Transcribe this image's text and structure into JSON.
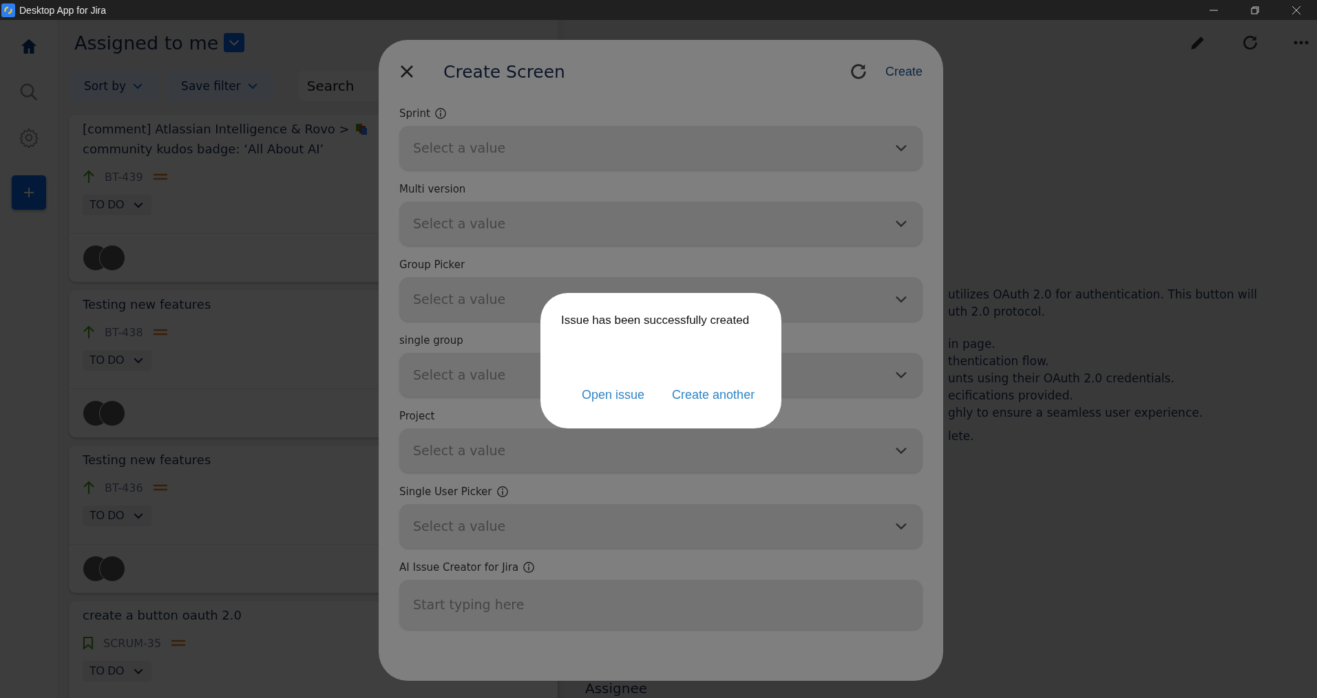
{
  "window": {
    "title": "Desktop App for Jira"
  },
  "sidebar": {
    "items": [
      {
        "kind": "home",
        "selected": true
      },
      {
        "kind": "search",
        "selected": false
      },
      {
        "kind": "settings",
        "selected": false
      },
      {
        "kind": "add",
        "selected": false
      }
    ]
  },
  "list": {
    "title": "Assigned to me",
    "buttons": [
      "Sort by",
      "Save filter"
    ],
    "search": {
      "placeholder": "Search"
    },
    "issues": [
      {
        "title": "[comment] Atlassian Intelligence & Rovo >",
        "title_cont": "community kudos badge: ‘All About AI’",
        "kind": "improvement",
        "key": "BT-439",
        "status": "TO DO"
      },
      {
        "title": "Testing new features",
        "kind": "improvement",
        "key": "BT-438",
        "status": "TO DO"
      },
      {
        "title": "Testing new features",
        "kind": "improvement",
        "key": "BT-436",
        "status": "TO DO"
      },
      {
        "title": "create a button oauth 2.0",
        "kind": "story",
        "key": "SCRUM-35",
        "status": "TO DO"
      }
    ]
  },
  "detail": {
    "paragraphs": [
      [
        "utilizes OAuth 2.0 for authentication. This button will",
        "uth 2.0 protocol."
      ],
      [
        "in page.",
        "thentication flow.",
        "unts using their OAuth 2.0 credentials.",
        "ecifications provided.",
        "ghly to ensure a seamless user experience."
      ],
      [
        "lete."
      ]
    ],
    "assignee_label": "Assignee"
  },
  "modal": {
    "title": "Create Screen",
    "action": "Create",
    "fields": [
      {
        "label": "Sprint",
        "info": true,
        "kind": "select",
        "placeholder": "Select a value"
      },
      {
        "label": "Multi version",
        "info": false,
        "kind": "select",
        "placeholder": "Select a value"
      },
      {
        "label": "Group Picker",
        "info": false,
        "kind": "select",
        "placeholder": "Select a value"
      },
      {
        "label": "single group",
        "info": false,
        "kind": "select",
        "placeholder": "Select a value"
      },
      {
        "label": "Project",
        "info": false,
        "kind": "select",
        "placeholder": "Select a value"
      },
      {
        "label": "Single User Picker",
        "info": true,
        "kind": "select",
        "placeholder": "Select a value"
      },
      {
        "label": "AI Issue Creator for Jira",
        "info": true,
        "kind": "text",
        "placeholder": "Start typing here"
      }
    ]
  },
  "dialog": {
    "message": "Issue has been successfully created",
    "buttons": [
      "Open issue",
      "Create another"
    ]
  }
}
